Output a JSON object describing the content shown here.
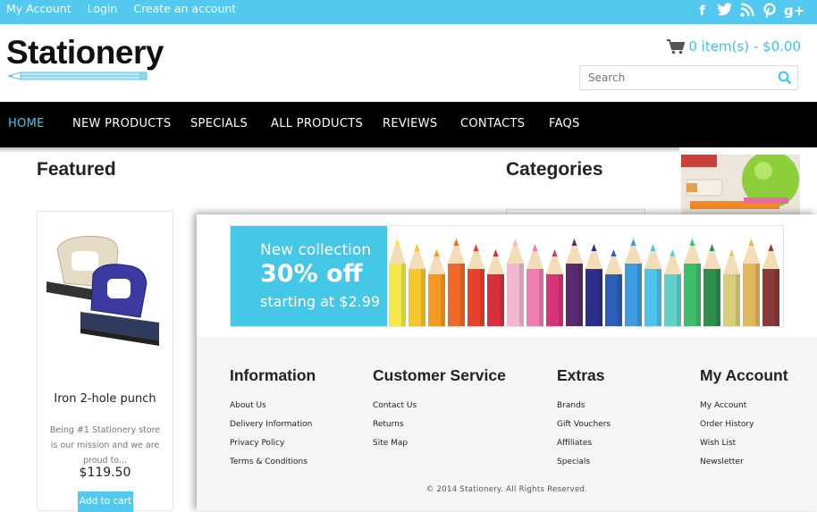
{
  "topbar": {
    "links": [
      "My Account",
      "Login",
      "Create an account"
    ],
    "social_icons": [
      "facebook-icon",
      "twitter-icon",
      "rss-icon",
      "pinterest-icon",
      "google-plus-icon"
    ],
    "background": "#54c9ef"
  },
  "header": {
    "logo_text": "Stationery",
    "cart_text": "0 item(s) - $0.00",
    "search_placeholder": "Search"
  },
  "nav": {
    "items": [
      "HOME",
      "NEW PRODUCTS",
      "SPECIALS",
      "ALL PRODUCTS",
      "REVIEWS",
      "CONTACTS",
      "FAQS"
    ],
    "active": "HOME",
    "active_color": "#4fc6ee"
  },
  "featured": {
    "title": "Featured",
    "product": {
      "name": "Iron 2-hole punch",
      "description": "Being #1 Stationery store is our mission and we are proud to...",
      "price": "$119.50",
      "button": "Add to cart"
    }
  },
  "sidebar": {
    "categories_title": "Categories"
  },
  "banner": {
    "line1": "New collection",
    "line2": "30% off",
    "line3": "starting at $2.99",
    "color": "#45c7e7"
  },
  "footer": {
    "columns": [
      {
        "title": "Information",
        "links": [
          "About Us",
          "Delivery Information",
          "Privacy Policy",
          "Terms & Conditions"
        ]
      },
      {
        "title": "Customer Service",
        "links": [
          "Contact Us",
          "Returns",
          "Site Map"
        ]
      },
      {
        "title": "Extras",
        "links": [
          "Brands",
          "Gift Vouchers",
          "Affiliates",
          "Specials"
        ]
      },
      {
        "title": "My Account",
        "links": [
          "My Account",
          "Order History",
          "Wish List",
          "Newsletter"
        ]
      }
    ],
    "copyright": "© 2014 Stationery. All Rights Reserved."
  }
}
